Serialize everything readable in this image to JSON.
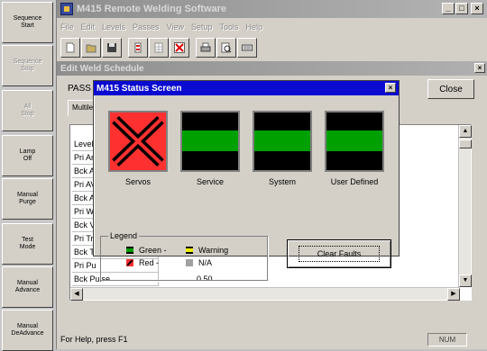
{
  "left_panel": {
    "buttons": [
      {
        "id": "sequence-start",
        "label": "Sequence\nStart",
        "enabled": true
      },
      {
        "id": "sequence-stop",
        "label": "Sequence\nStop",
        "enabled": false
      },
      {
        "id": "all-stop",
        "label": "All\nStop",
        "enabled": false
      },
      {
        "id": "lamp-off",
        "label": "Lamp\nOff",
        "enabled": true
      },
      {
        "id": "manual-purge",
        "label": "Manual\nPurge",
        "enabled": true
      },
      {
        "id": "test-mode",
        "label": "Test\nMode",
        "enabled": true
      },
      {
        "id": "manual-advance",
        "label": "Manual\nAdvance",
        "enabled": true
      },
      {
        "id": "manual-deadvance",
        "label": "Manual\nDeAdvance",
        "enabled": true
      }
    ]
  },
  "app": {
    "title": "M415 Remote Welding Software",
    "caption_buttons": {
      "minimize": "_",
      "maximize": "□",
      "close": "×"
    }
  },
  "menu": [
    "File",
    "Edit",
    "Levels",
    "Passes",
    "View",
    "Setup",
    "Tools",
    "Help"
  ],
  "toolbar": [
    "new-icon",
    "open-icon",
    "save-icon",
    "red-doc-icon",
    "grid-doc-icon",
    "red-x-icon",
    "print-icon",
    "print-preview-icon",
    "keyboard-icon"
  ],
  "edit_window": {
    "title": "Edit Weld Schedule",
    "close_glyph": "×",
    "pass_label": "PASS 1",
    "close_button": "Close",
    "tab": "Multile",
    "rows": [
      "Level",
      "Pri Ar",
      "Bck A",
      "Pri AV",
      "Bck A",
      "Pri W",
      "Bck V",
      "Pri Tr",
      "Bck T",
      "Pri Pu",
      "Bck Pulse"
    ],
    "last_value": "0.50"
  },
  "status_dialog": {
    "title": "M415 Status Screen",
    "close_glyph": "×",
    "panels": [
      {
        "label": "Servos",
        "state": "fault"
      },
      {
        "label": "Service",
        "state": "ok"
      },
      {
        "label": "System",
        "state": "ok"
      },
      {
        "label": "User Defined",
        "state": "ok"
      }
    ],
    "legend": {
      "title": "Legend",
      "green": "Green -",
      "red": "Red -",
      "warning": "Warning",
      "na": "N/A"
    },
    "clear_button": "Clear Faults",
    "colors": {
      "ok": "#00a000",
      "fault": "#ff3030",
      "warning": "#f0f000",
      "na": "#a0a0a0"
    }
  },
  "statusbar": {
    "text": "For Help, press F1",
    "num": "NUM"
  }
}
